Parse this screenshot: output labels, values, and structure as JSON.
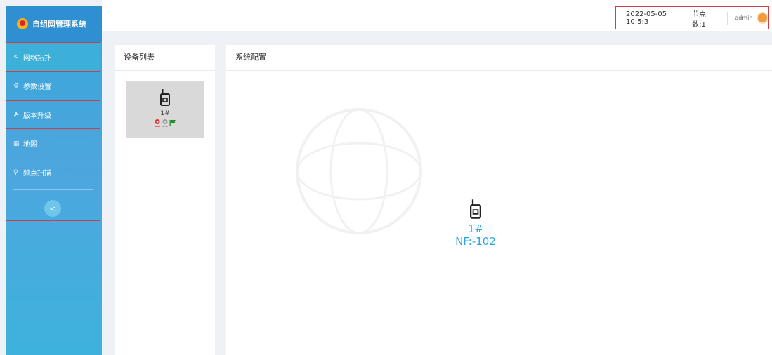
{
  "brand": {
    "title": "自组网管理系统"
  },
  "sidebar": {
    "items": [
      {
        "label": "网络拓扑",
        "icon": "share-icon"
      },
      {
        "label": "参数设置",
        "icon": "gear-icon"
      },
      {
        "label": "版本升级",
        "icon": "wrench-icon"
      },
      {
        "label": "地图",
        "icon": "map-icon"
      },
      {
        "label": "频点扫描",
        "icon": "search-icon"
      }
    ],
    "collapse_label": "<"
  },
  "header": {
    "datetime": "2022-05-05 10:5:3",
    "node_count": "节点数:1",
    "user": "admin"
  },
  "device_list": {
    "title": "设备列表",
    "devices": [
      {
        "name": "1#"
      }
    ]
  },
  "config": {
    "title": "系统配置",
    "node_name": "1#",
    "node_nf": "NF:-102"
  },
  "colors": {
    "sidebar": "#3aa9dc",
    "accent": "#2aa6e0",
    "highlight_border": "#c9404a"
  }
}
